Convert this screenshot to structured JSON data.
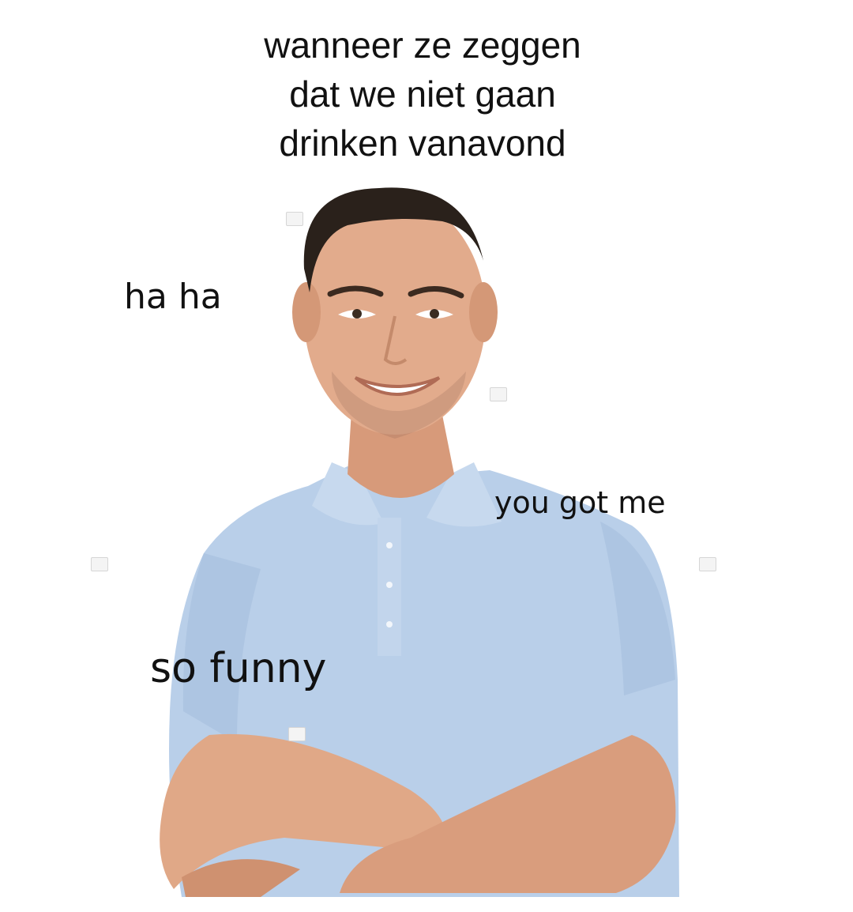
{
  "meme": {
    "caption_lines": [
      "wanneer ze zeggen",
      "dat we niet gaan",
      "drinken vanavond"
    ],
    "labels": {
      "haha": "ha ha",
      "you_got_me": "you got me",
      "so_funny": "so funny"
    }
  },
  "colors": {
    "background": "#ffffff",
    "shirt": "#b9cfe9",
    "skin": "#e2ab8c",
    "hair": "#2a211b",
    "text": "#111111"
  }
}
